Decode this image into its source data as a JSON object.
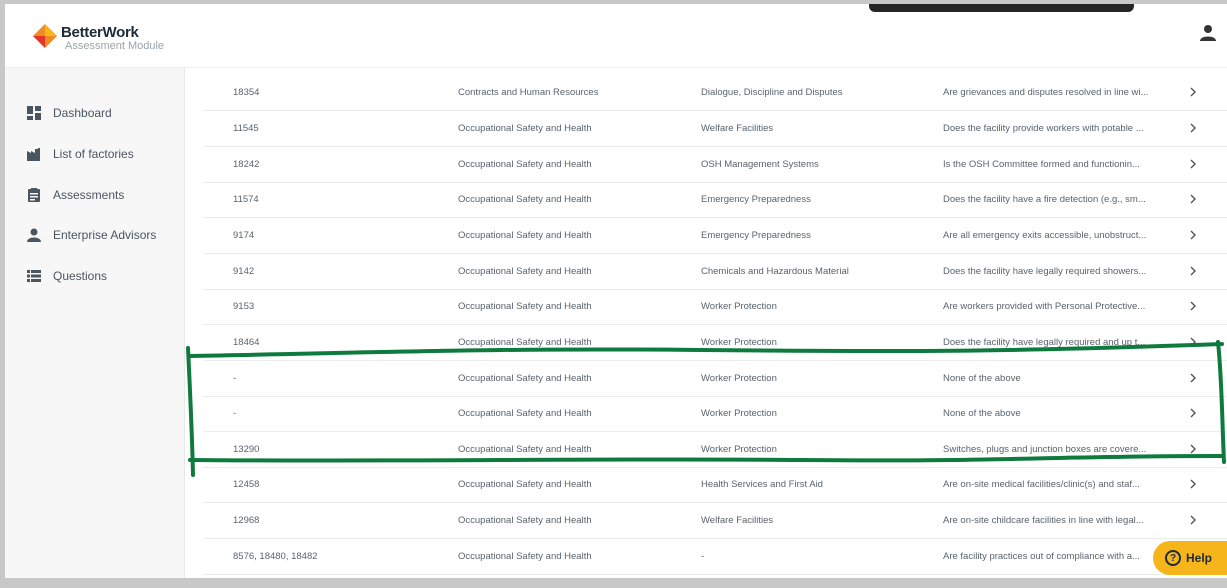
{
  "app": {
    "brand": "BetterWork",
    "module": "Assessment Module"
  },
  "sidebar": {
    "items": [
      {
        "label": "Dashboard",
        "icon": "dashboard-icon"
      },
      {
        "label": "List of factories",
        "icon": "factory-icon"
      },
      {
        "label": "Assessments",
        "icon": "clipboard-icon"
      },
      {
        "label": "Enterprise Advisors",
        "icon": "user-icon"
      },
      {
        "label": "Questions",
        "icon": "list-icon"
      }
    ]
  },
  "table": {
    "rows": [
      {
        "id": "18354",
        "area": "Contracts and Human Resources",
        "subarea": "Dialogue, Discipline and Disputes",
        "question": "Are grievances and disputes resolved in line wi..."
      },
      {
        "id": "11545",
        "area": "Occupational Safety and Health",
        "subarea": "Welfare Facilities",
        "question": "Does the facility provide workers with potable ..."
      },
      {
        "id": "18242",
        "area": "Occupational Safety and Health",
        "subarea": "OSH Management Systems",
        "question": "Is the OSH Committee formed and functionin..."
      },
      {
        "id": "11574",
        "area": "Occupational Safety and Health",
        "subarea": "Emergency Preparedness",
        "question": "Does the facility have a fire detection (e.g., sm..."
      },
      {
        "id": "9174",
        "area": "Occupational Safety and Health",
        "subarea": "Emergency Preparedness",
        "question": "Are all emergency exits accessible, unobstruct..."
      },
      {
        "id": "9142",
        "area": "Occupational Safety and Health",
        "subarea": "Chemicals and Hazardous Material",
        "question": "Does the facility have legally required showers..."
      },
      {
        "id": "9153",
        "area": "Occupational Safety and Health",
        "subarea": "Worker Protection",
        "question": "Are workers provided with Personal Protective..."
      },
      {
        "id": "18464",
        "area": "Occupational Safety and Health",
        "subarea": "Worker Protection",
        "question": "Does the facility have legally required and up t..."
      },
      {
        "id": "-",
        "area": "Occupational Safety and Health",
        "subarea": "Worker Protection",
        "question": "None of the above"
      },
      {
        "id": "-",
        "area": "Occupational Safety and Health",
        "subarea": "Worker Protection",
        "question": "None of the above"
      },
      {
        "id": "13290",
        "area": "Occupational Safety and Health",
        "subarea": "Worker Protection",
        "question": "Switches, plugs and junction boxes are covere..."
      },
      {
        "id": "12458",
        "area": "Occupational Safety and Health",
        "subarea": "Health Services and First Aid",
        "question": "Are on-site medical facilities/clinic(s) and staf..."
      },
      {
        "id": "12968",
        "area": "Occupational Safety and Health",
        "subarea": "Welfare Facilities",
        "question": "Are on-site childcare facilities in line with legal..."
      },
      {
        "id": "8576, 18480, 18482",
        "area": "Occupational Safety and Health",
        "subarea": "-",
        "question": "Are facility practices out of compliance with a..."
      }
    ]
  },
  "help": {
    "label": "Help",
    "icon": "?"
  },
  "colors": {
    "brand_orange": "#f08a24",
    "brand_red": "#e4352b",
    "help_bg": "#f5b51b",
    "annotation_green": "#0f7a3e"
  }
}
